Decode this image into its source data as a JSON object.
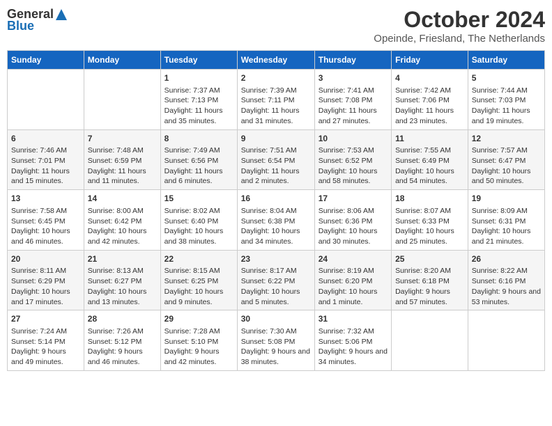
{
  "header": {
    "logo_general": "General",
    "logo_blue": "Blue",
    "month": "October 2024",
    "location": "Opeinde, Friesland, The Netherlands"
  },
  "days_of_week": [
    "Sunday",
    "Monday",
    "Tuesday",
    "Wednesday",
    "Thursday",
    "Friday",
    "Saturday"
  ],
  "weeks": [
    [
      {
        "day": "",
        "content": ""
      },
      {
        "day": "",
        "content": ""
      },
      {
        "day": "1",
        "content": "Sunrise: 7:37 AM\nSunset: 7:13 PM\nDaylight: 11 hours and 35 minutes."
      },
      {
        "day": "2",
        "content": "Sunrise: 7:39 AM\nSunset: 7:11 PM\nDaylight: 11 hours and 31 minutes."
      },
      {
        "day": "3",
        "content": "Sunrise: 7:41 AM\nSunset: 7:08 PM\nDaylight: 11 hours and 27 minutes."
      },
      {
        "day": "4",
        "content": "Sunrise: 7:42 AM\nSunset: 7:06 PM\nDaylight: 11 hours and 23 minutes."
      },
      {
        "day": "5",
        "content": "Sunrise: 7:44 AM\nSunset: 7:03 PM\nDaylight: 11 hours and 19 minutes."
      }
    ],
    [
      {
        "day": "6",
        "content": "Sunrise: 7:46 AM\nSunset: 7:01 PM\nDaylight: 11 hours and 15 minutes."
      },
      {
        "day": "7",
        "content": "Sunrise: 7:48 AM\nSunset: 6:59 PM\nDaylight: 11 hours and 11 minutes."
      },
      {
        "day": "8",
        "content": "Sunrise: 7:49 AM\nSunset: 6:56 PM\nDaylight: 11 hours and 6 minutes."
      },
      {
        "day": "9",
        "content": "Sunrise: 7:51 AM\nSunset: 6:54 PM\nDaylight: 11 hours and 2 minutes."
      },
      {
        "day": "10",
        "content": "Sunrise: 7:53 AM\nSunset: 6:52 PM\nDaylight: 10 hours and 58 minutes."
      },
      {
        "day": "11",
        "content": "Sunrise: 7:55 AM\nSunset: 6:49 PM\nDaylight: 10 hours and 54 minutes."
      },
      {
        "day": "12",
        "content": "Sunrise: 7:57 AM\nSunset: 6:47 PM\nDaylight: 10 hours and 50 minutes."
      }
    ],
    [
      {
        "day": "13",
        "content": "Sunrise: 7:58 AM\nSunset: 6:45 PM\nDaylight: 10 hours and 46 minutes."
      },
      {
        "day": "14",
        "content": "Sunrise: 8:00 AM\nSunset: 6:42 PM\nDaylight: 10 hours and 42 minutes."
      },
      {
        "day": "15",
        "content": "Sunrise: 8:02 AM\nSunset: 6:40 PM\nDaylight: 10 hours and 38 minutes."
      },
      {
        "day": "16",
        "content": "Sunrise: 8:04 AM\nSunset: 6:38 PM\nDaylight: 10 hours and 34 minutes."
      },
      {
        "day": "17",
        "content": "Sunrise: 8:06 AM\nSunset: 6:36 PM\nDaylight: 10 hours and 30 minutes."
      },
      {
        "day": "18",
        "content": "Sunrise: 8:07 AM\nSunset: 6:33 PM\nDaylight: 10 hours and 25 minutes."
      },
      {
        "day": "19",
        "content": "Sunrise: 8:09 AM\nSunset: 6:31 PM\nDaylight: 10 hours and 21 minutes."
      }
    ],
    [
      {
        "day": "20",
        "content": "Sunrise: 8:11 AM\nSunset: 6:29 PM\nDaylight: 10 hours and 17 minutes."
      },
      {
        "day": "21",
        "content": "Sunrise: 8:13 AM\nSunset: 6:27 PM\nDaylight: 10 hours and 13 minutes."
      },
      {
        "day": "22",
        "content": "Sunrise: 8:15 AM\nSunset: 6:25 PM\nDaylight: 10 hours and 9 minutes."
      },
      {
        "day": "23",
        "content": "Sunrise: 8:17 AM\nSunset: 6:22 PM\nDaylight: 10 hours and 5 minutes."
      },
      {
        "day": "24",
        "content": "Sunrise: 8:19 AM\nSunset: 6:20 PM\nDaylight: 10 hours and 1 minute."
      },
      {
        "day": "25",
        "content": "Sunrise: 8:20 AM\nSunset: 6:18 PM\nDaylight: 9 hours and 57 minutes."
      },
      {
        "day": "26",
        "content": "Sunrise: 8:22 AM\nSunset: 6:16 PM\nDaylight: 9 hours and 53 minutes."
      }
    ],
    [
      {
        "day": "27",
        "content": "Sunrise: 7:24 AM\nSunset: 5:14 PM\nDaylight: 9 hours and 49 minutes."
      },
      {
        "day": "28",
        "content": "Sunrise: 7:26 AM\nSunset: 5:12 PM\nDaylight: 9 hours and 46 minutes."
      },
      {
        "day": "29",
        "content": "Sunrise: 7:28 AM\nSunset: 5:10 PM\nDaylight: 9 hours and 42 minutes."
      },
      {
        "day": "30",
        "content": "Sunrise: 7:30 AM\nSunset: 5:08 PM\nDaylight: 9 hours and 38 minutes."
      },
      {
        "day": "31",
        "content": "Sunrise: 7:32 AM\nSunset: 5:06 PM\nDaylight: 9 hours and 34 minutes."
      },
      {
        "day": "",
        "content": ""
      },
      {
        "day": "",
        "content": ""
      }
    ]
  ]
}
